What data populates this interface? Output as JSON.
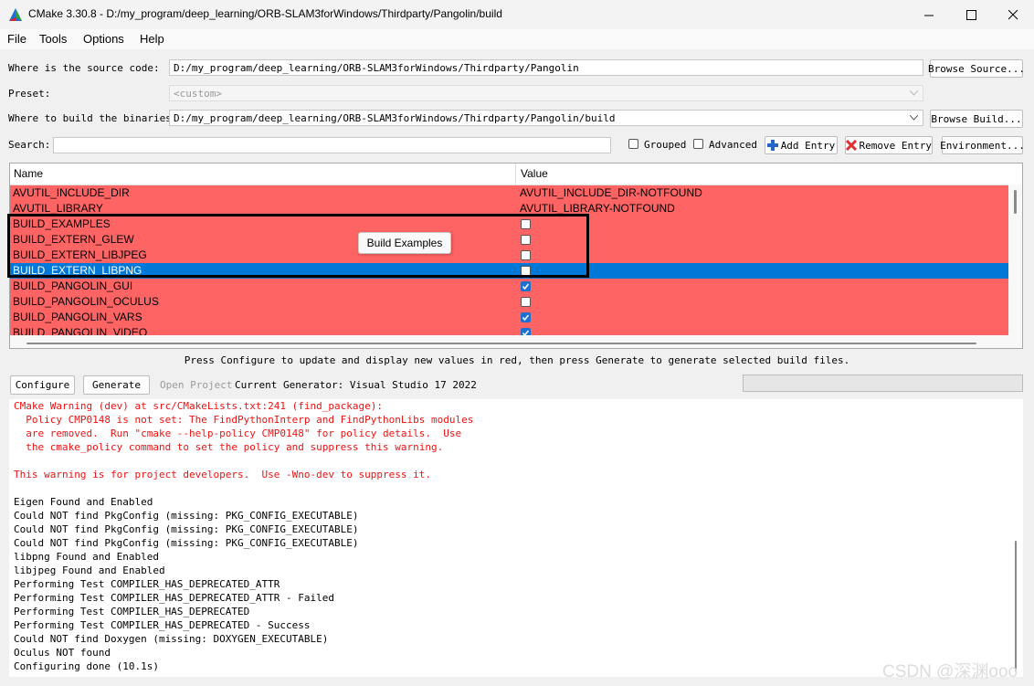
{
  "window": {
    "title": "CMake 3.30.8 - D:/my_program/deep_learning/ORB-SLAM3forWindows/Thirdparty/Pangolin/build",
    "icons": [
      "cmake-logo",
      "minimize-icon",
      "maximize-icon",
      "close-icon"
    ]
  },
  "menu": [
    "File",
    "Tools",
    "Options",
    "Help"
  ],
  "form": {
    "source_label": "Where is the source code:",
    "source_value": "D:/my_program/deep_learning/ORB-SLAM3forWindows/Thirdparty/Pangolin",
    "browse_source": "Browse Source...",
    "preset_label": "Preset:",
    "preset_value": "<custom>",
    "build_label": "Where to build the binaries:",
    "build_value": "D:/my_program/deep_learning/ORB-SLAM3forWindows/Thirdparty/Pangolin/build",
    "browse_build": "Browse Build...",
    "search_label": "Search:",
    "search_value": "",
    "grouped": "Grouped",
    "advanced": "Advanced",
    "add_entry": "Add Entry",
    "remove_entry": "Remove Entry",
    "environment": "Environment..."
  },
  "table": {
    "headers": [
      "Name",
      "Value"
    ],
    "rows": [
      {
        "name": "AVUTIL_INCLUDE_DIR",
        "value": "AVUTIL_INCLUDE_DIR-NOTFOUND",
        "checkbox": false,
        "checked": false,
        "selected": false
      },
      {
        "name": "AVUTIL_LIBRARY",
        "value": "AVUTIL_LIBRARY-NOTFOUND",
        "checkbox": false,
        "checked": false,
        "selected": false
      },
      {
        "name": "BUILD_EXAMPLES",
        "value": "",
        "checkbox": true,
        "checked": false,
        "selected": false
      },
      {
        "name": "BUILD_EXTERN_GLEW",
        "value": "",
        "checkbox": true,
        "checked": false,
        "selected": false
      },
      {
        "name": "BUILD_EXTERN_LIBJPEG",
        "value": "",
        "checkbox": true,
        "checked": false,
        "selected": false
      },
      {
        "name": "BUILD_EXTERN_LIBPNG",
        "value": "",
        "checkbox": true,
        "checked": false,
        "selected": true
      },
      {
        "name": "BUILD_PANGOLIN_GUI",
        "value": "",
        "checkbox": true,
        "checked": true,
        "selected": false
      },
      {
        "name": "BUILD_PANGOLIN_OCULUS",
        "value": "",
        "checkbox": true,
        "checked": false,
        "selected": false
      },
      {
        "name": "BUILD_PANGOLIN_VARS",
        "value": "",
        "checkbox": true,
        "checked": true,
        "selected": false
      },
      {
        "name": "BUILD_PANGOLIN_VIDEO",
        "value": "",
        "checkbox": true,
        "checked": true,
        "selected": false
      }
    ],
    "tooltip": "Build Examples",
    "colors": {
      "changed_row": "#ff6464",
      "selected_row": "#0078d7",
      "highlight_box": "#000000"
    }
  },
  "hint": "Press Configure to update and display new values in red, then press Generate to generate selected build files.",
  "actions": {
    "configure": "Configure",
    "generate": "Generate",
    "open_project": "Open Project",
    "generator": "Current Generator: Visual Studio 17 2022",
    "progress": 0
  },
  "output": {
    "lines": [
      {
        "text": "CMake Warning (dev) at src/CMakeLists.txt:241 (find_package):",
        "warn": true
      },
      {
        "text": "  Policy CMP0148 is not set: The FindPythonInterp and FindPythonLibs modules",
        "warn": true
      },
      {
        "text": "  are removed.  Run \"cmake --help-policy CMP0148\" for policy details.  Use",
        "warn": true
      },
      {
        "text": "  the cmake_policy command to set the policy and suppress this warning.",
        "warn": true
      },
      {
        "text": "",
        "warn": false
      },
      {
        "text": "This warning is for project developers.  Use -Wno-dev to suppress it.",
        "warn": true
      },
      {
        "text": "",
        "warn": false
      },
      {
        "text": "Eigen Found and Enabled",
        "warn": false
      },
      {
        "text": "Could NOT find PkgConfig (missing: PKG_CONFIG_EXECUTABLE)",
        "warn": false
      },
      {
        "text": "Could NOT find PkgConfig (missing: PKG_CONFIG_EXECUTABLE)",
        "warn": false
      },
      {
        "text": "Could NOT find PkgConfig (missing: PKG_CONFIG_EXECUTABLE)",
        "warn": false
      },
      {
        "text": "libpng Found and Enabled",
        "warn": false
      },
      {
        "text": "libjpeg Found and Enabled",
        "warn": false
      },
      {
        "text": "Performing Test COMPILER_HAS_DEPRECATED_ATTR",
        "warn": false
      },
      {
        "text": "Performing Test COMPILER_HAS_DEPRECATED_ATTR - Failed",
        "warn": false
      },
      {
        "text": "Performing Test COMPILER_HAS_DEPRECATED",
        "warn": false
      },
      {
        "text": "Performing Test COMPILER_HAS_DEPRECATED - Success",
        "warn": false
      },
      {
        "text": "Could NOT find Doxygen (missing: DOXYGEN_EXECUTABLE)",
        "warn": false
      },
      {
        "text": "Oculus NOT found",
        "warn": false
      },
      {
        "text": "Configuring done (10.1s)",
        "warn": false
      }
    ]
  },
  "watermark": "CSDN @深渊ooo"
}
